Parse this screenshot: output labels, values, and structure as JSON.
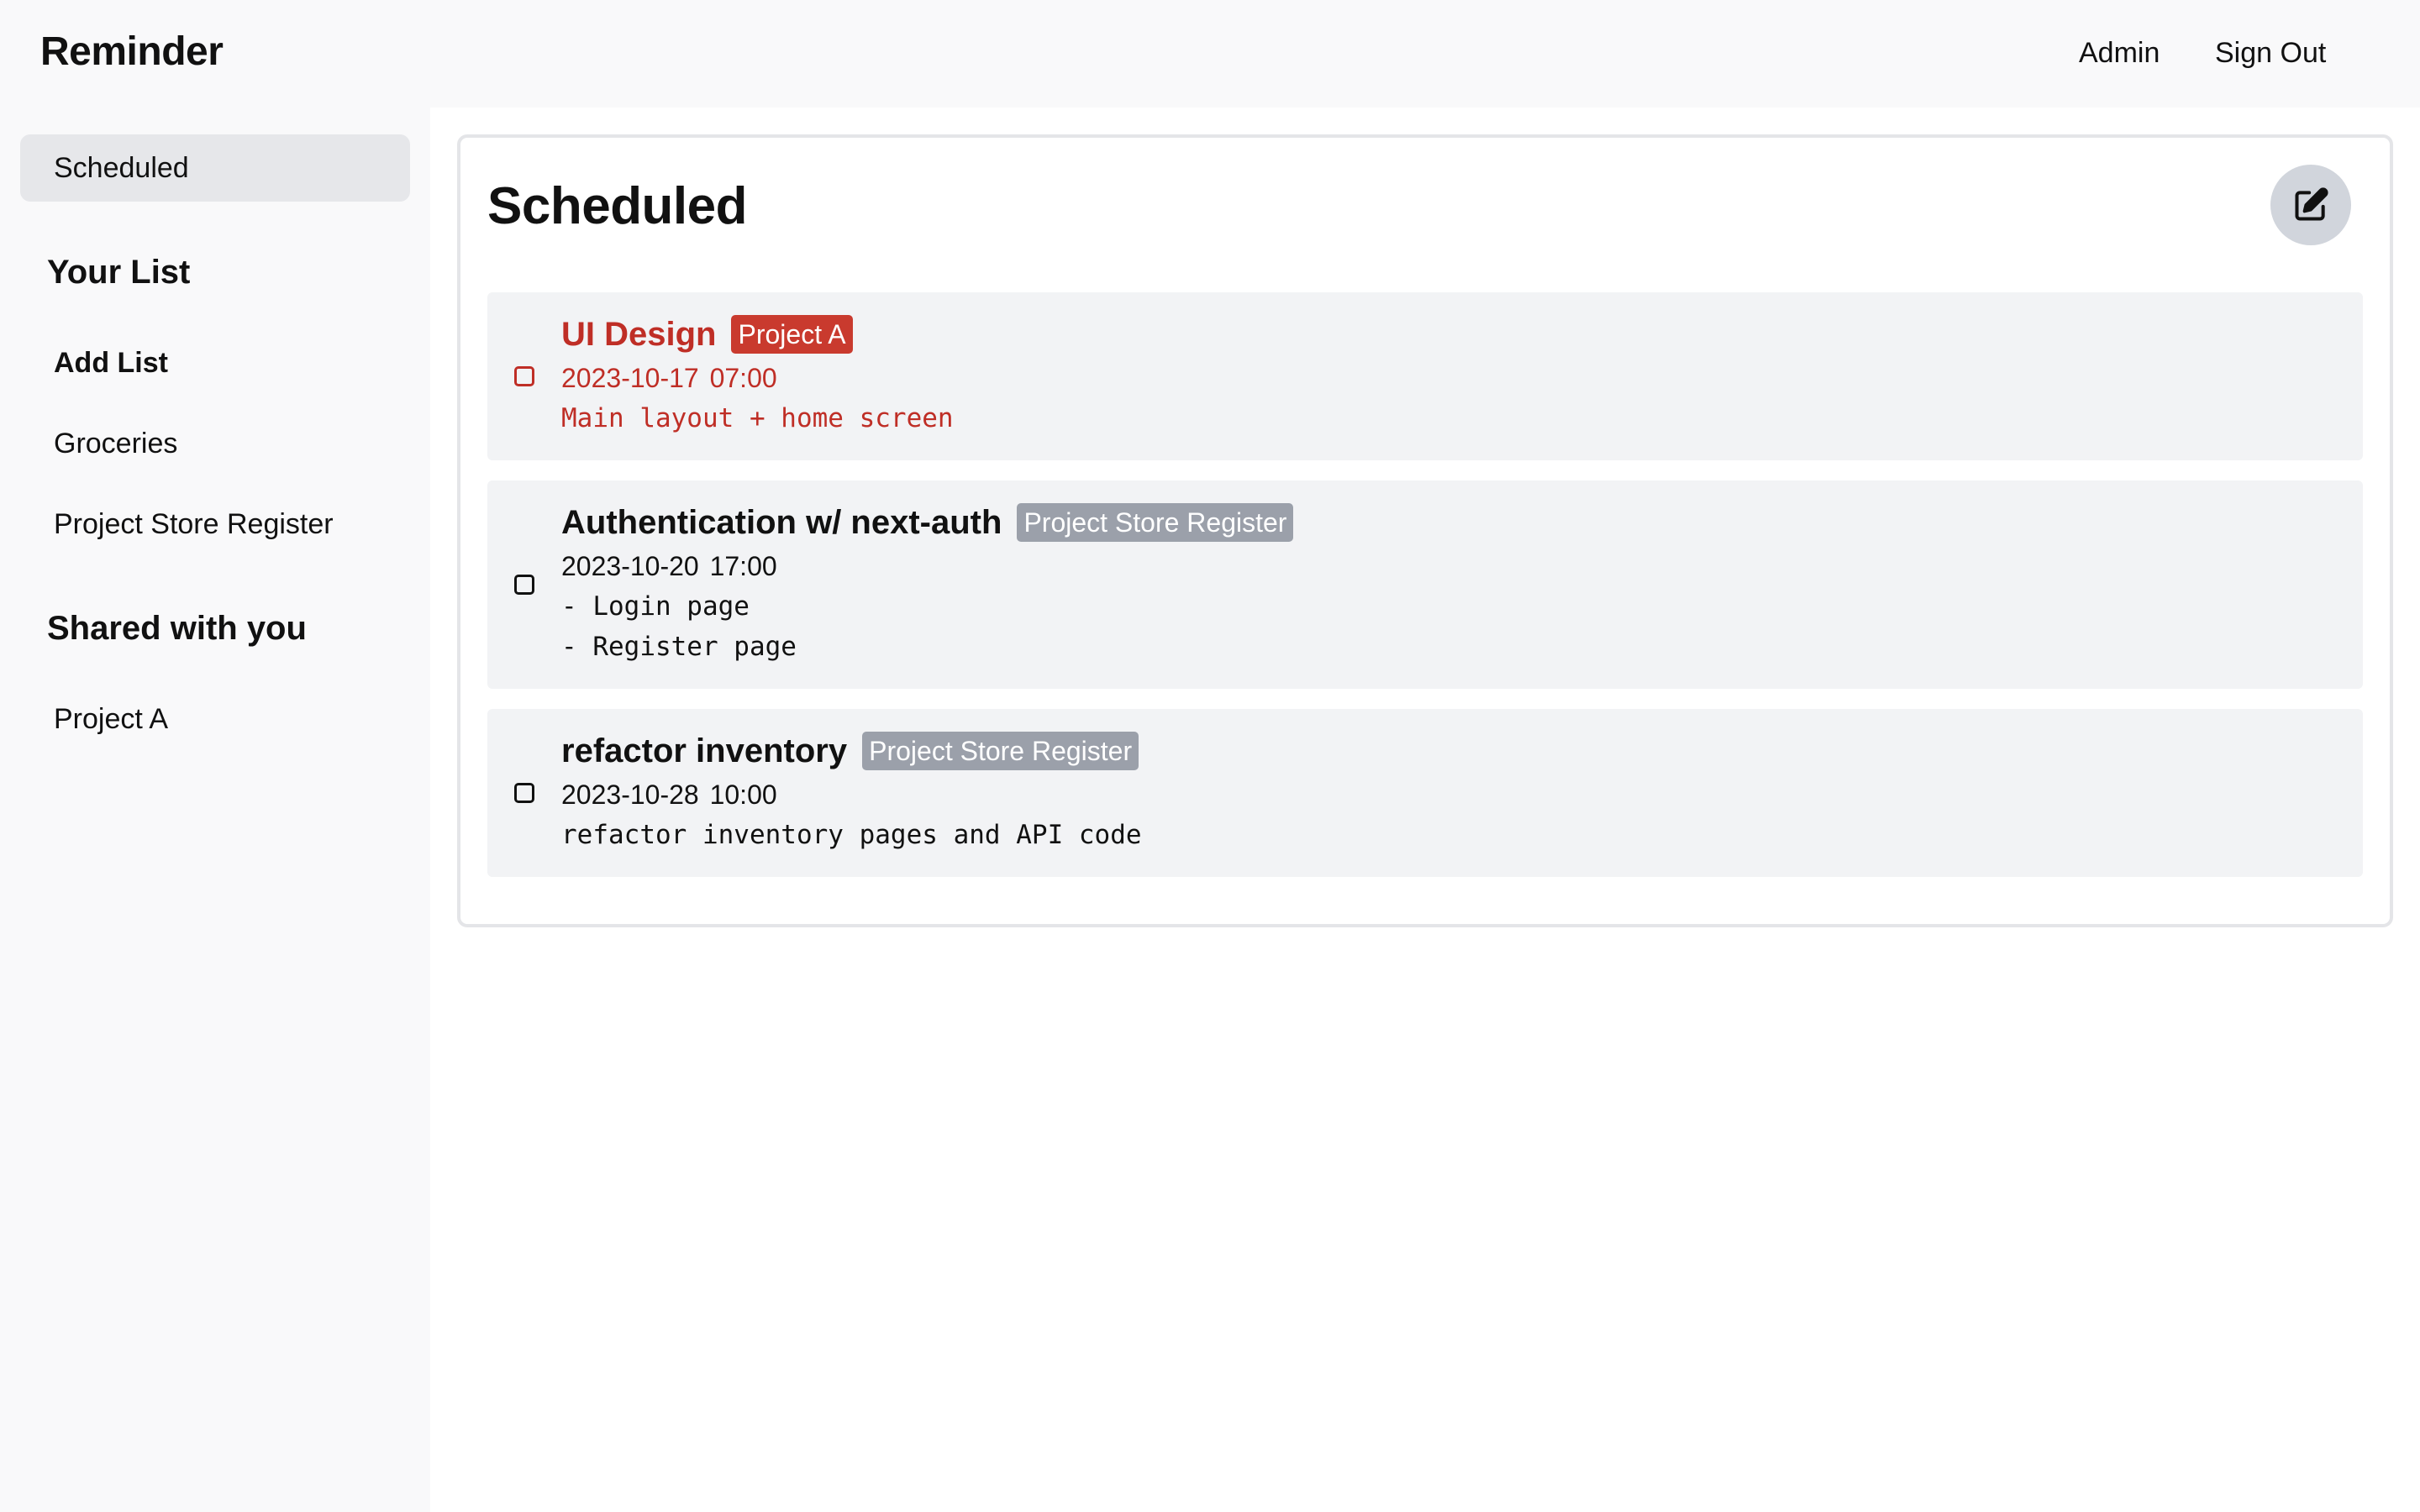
{
  "header": {
    "app_title": "Reminder",
    "admin_label": "Admin",
    "signout_label": "Sign Out"
  },
  "sidebar": {
    "scheduled_label": "Scheduled",
    "your_list_title": "Your List",
    "add_list_label": "Add List",
    "lists": [
      "Groceries",
      "Project Store Register"
    ],
    "shared_title": "Shared with you",
    "shared_lists": [
      "Project A"
    ]
  },
  "main": {
    "title": "Scheduled",
    "edit_icon": "edit-icon",
    "tasks": [
      {
        "title": "UI Design",
        "badge": "Project A",
        "datetime": "2023-10-17  07:00",
        "note_lines": [
          "Main layout + home screen"
        ],
        "overdue": true
      },
      {
        "title": "Authentication w/ next-auth",
        "badge": "Project Store Register",
        "datetime": "2023-10-20  17:00",
        "note_lines": [
          "- Login page",
          "- Register page"
        ],
        "overdue": false
      },
      {
        "title": "refactor inventory",
        "badge": "Project Store Register",
        "datetime": "2023-10-28  10:00",
        "note_lines": [
          "refactor inventory pages and API code"
        ],
        "overdue": false
      }
    ]
  },
  "colors": {
    "overdue": "#bf2e26",
    "overdue_badge": "#c93a2e",
    "badge": "#9ba0aa",
    "active_nav": "#e6e7ea",
    "task_bg": "#f2f3f5"
  }
}
